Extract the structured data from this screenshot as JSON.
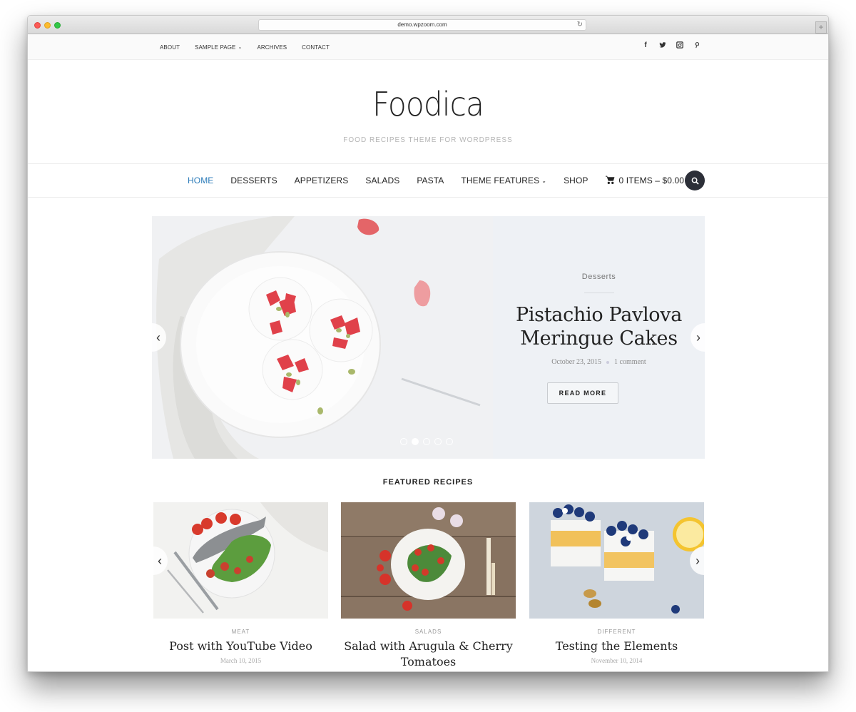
{
  "browser": {
    "url": "demo.wpzoom.com",
    "reload_icon": "reload-icon",
    "new_tab_label": "+"
  },
  "topbar": {
    "nav": [
      {
        "label": "ABOUT"
      },
      {
        "label": "SAMPLE PAGE",
        "dropdown": true
      },
      {
        "label": "ARCHIVES"
      },
      {
        "label": "CONTACT"
      }
    ],
    "social": [
      "facebook-icon",
      "twitter-icon",
      "instagram-icon",
      "pinterest-icon"
    ]
  },
  "header": {
    "logo": "Foodica",
    "tagline": "FOOD RECIPES THEME FOR WORDPRESS"
  },
  "mainnav": {
    "items": [
      {
        "label": "HOME",
        "active": true
      },
      {
        "label": "DESSERTS"
      },
      {
        "label": "APPETIZERS"
      },
      {
        "label": "SALADS"
      },
      {
        "label": "PASTA"
      },
      {
        "label": "THEME FEATURES",
        "dropdown": true
      },
      {
        "label": "SHOP"
      }
    ],
    "cart": "0 ITEMS – $0.00",
    "accent": "#2b7bb9"
  },
  "slider": {
    "category": "Desserts",
    "title": "Pistachio Pavlova Meringue Cakes",
    "date": "October 23, 2015",
    "comments": "1 comment",
    "button": "READ MORE",
    "slides_total": 5,
    "active_slide": 2
  },
  "featured": {
    "heading": "FEATURED RECIPES",
    "cards": [
      {
        "category": "MEAT",
        "title": "Post with YouTube Video",
        "date": "March 10, 2015"
      },
      {
        "category": "SALADS",
        "title": "Salad with Arugula & Cherry Tomatoes",
        "date": ""
      },
      {
        "category": "DIFFERENT",
        "title": "Testing the Elements",
        "date": "November 10, 2014"
      }
    ]
  }
}
